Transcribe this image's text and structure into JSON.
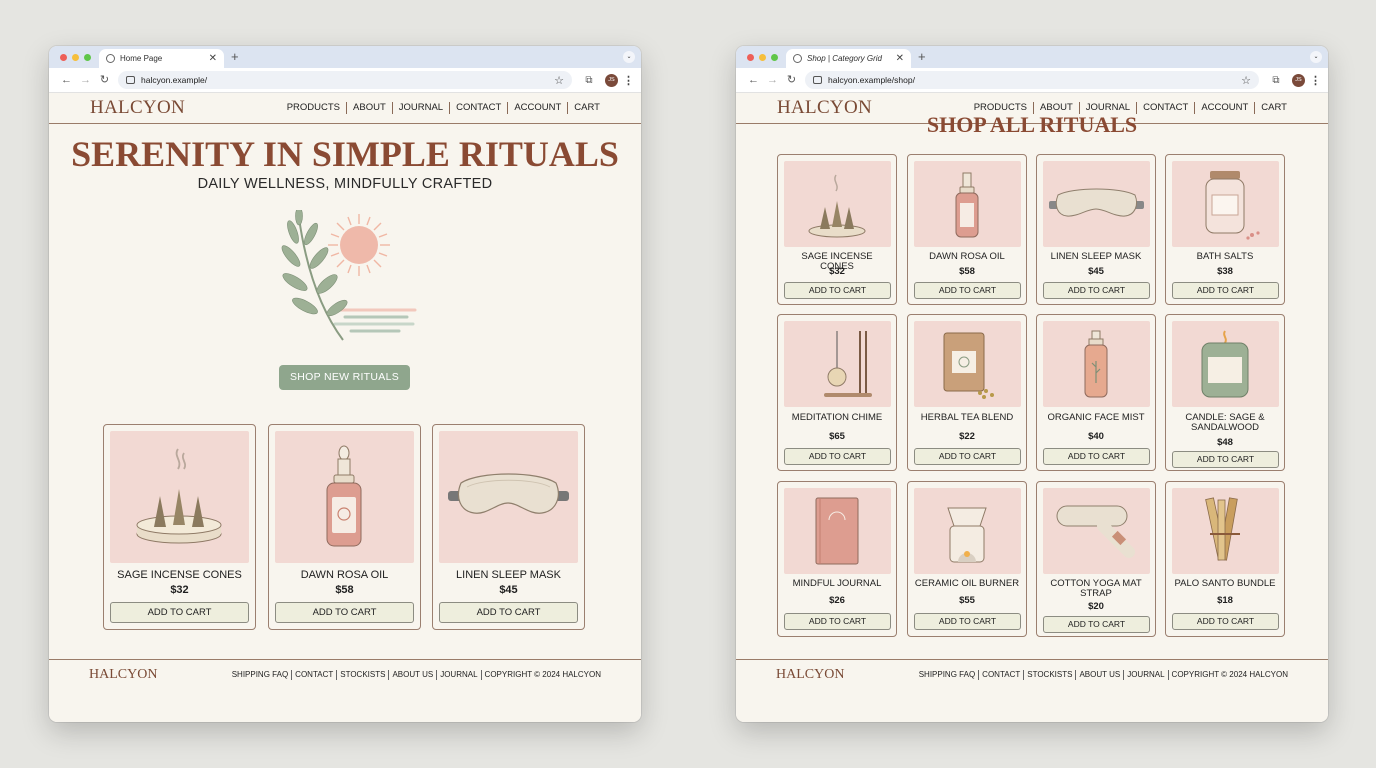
{
  "colors": {
    "brand": "#7a4a35",
    "heading": "#8a4a33",
    "accent_button": "#8fa68d",
    "card_image_bg": "#f2d9d3",
    "page_bg": "#f8f5ee",
    "tab_strip": "#dce4f1"
  },
  "left_window": {
    "tab": {
      "title": "Home Page",
      "close_icon": "close-icon"
    },
    "url": "halcyon.example/",
    "avatar_initials": "JS",
    "site": {
      "logo": "HALCYON",
      "nav": [
        "PRODUCTS",
        "ABOUT",
        "JOURNAL",
        "CONTACT",
        "ACCOUNT",
        "CART"
      ]
    },
    "hero": {
      "title": "SERENITY IN SIMPLE RITUALS",
      "subtitle": "DAILY WELLNESS, MINDFULLY CRAFTED",
      "illustration_icon": "olive-branch-sun-icon",
      "cta": "SHOP NEW RITUALS"
    },
    "products": [
      {
        "name": "SAGE INCENSE CONES",
        "price": "$32",
        "button": "ADD TO CART",
        "icon": "incense-cones-icon"
      },
      {
        "name": "DAWN ROSA OIL",
        "price": "$58",
        "button": "ADD TO CART",
        "icon": "dropper-bottle-icon"
      },
      {
        "name": "LINEN SLEEP MASK",
        "price": "$45",
        "button": "ADD TO CART",
        "icon": "sleep-mask-icon"
      }
    ],
    "footer": {
      "logo": "HALCYON",
      "links": [
        "SHIPPING FAQ",
        "CONTACT",
        "STOCKISTS",
        "ABOUT US",
        "JOURNAL",
        "COPYRIGHT © 2024 HALCYON"
      ]
    }
  },
  "right_window": {
    "tab": {
      "title": "Shop | Category Grid",
      "close_icon": "close-icon"
    },
    "url": "halcyon.example/shop/",
    "avatar_initials": "JS",
    "site": {
      "logo": "HALCYON",
      "nav": [
        "PRODUCTS",
        "ABOUT",
        "JOURNAL",
        "CONTACT",
        "ACCOUNT",
        "CART"
      ]
    },
    "heading": "SHOP ALL RITUALS",
    "products": [
      {
        "name": "SAGE INCENSE CONES",
        "price": "$32",
        "button": "ADD TO CART",
        "icon": "incense-cones-icon"
      },
      {
        "name": "DAWN ROSA OIL",
        "price": "$58",
        "button": "ADD TO CART",
        "icon": "dropper-bottle-icon"
      },
      {
        "name": "LINEN SLEEP MASK",
        "price": "$45",
        "button": "ADD TO CART",
        "icon": "sleep-mask-icon"
      },
      {
        "name": "BATH SALTS",
        "price": "$38",
        "button": "ADD TO CART",
        "icon": "bath-salt-jar-icon"
      },
      {
        "name": "MEDITATION CHIME",
        "price": "$65",
        "button": "ADD TO CART",
        "icon": "chime-icon"
      },
      {
        "name": "HERBAL TEA BLEND",
        "price": "$22",
        "button": "ADD TO CART",
        "icon": "tea-pouch-icon"
      },
      {
        "name": "ORGANIC FACE MIST",
        "price": "$40",
        "button": "ADD TO CART",
        "icon": "spray-bottle-icon"
      },
      {
        "name": "CANDLE: SAGE & SANDALWOOD",
        "price": "$48",
        "button": "ADD TO CART",
        "icon": "candle-icon"
      },
      {
        "name": "MINDFUL JOURNAL",
        "price": "$26",
        "button": "ADD TO CART",
        "icon": "journal-book-icon"
      },
      {
        "name": "CERAMIC OIL BURNER",
        "price": "$55",
        "button": "ADD TO CART",
        "icon": "oil-burner-icon"
      },
      {
        "name": "COTTON YOGA MAT STRAP",
        "price": "$20",
        "button": "ADD TO CART",
        "icon": "yoga-strap-icon"
      },
      {
        "name": "PALO SANTO BUNDLE",
        "price": "$18",
        "button": "ADD TO CART",
        "icon": "palo-santo-icon"
      }
    ],
    "footer": {
      "logo": "HALCYON",
      "links": [
        "SHIPPING FAQ",
        "CONTACT",
        "STOCKISTS",
        "ABOUT US",
        "JOURNAL",
        "COPYRIGHT © 2024 HALCYON"
      ]
    }
  }
}
